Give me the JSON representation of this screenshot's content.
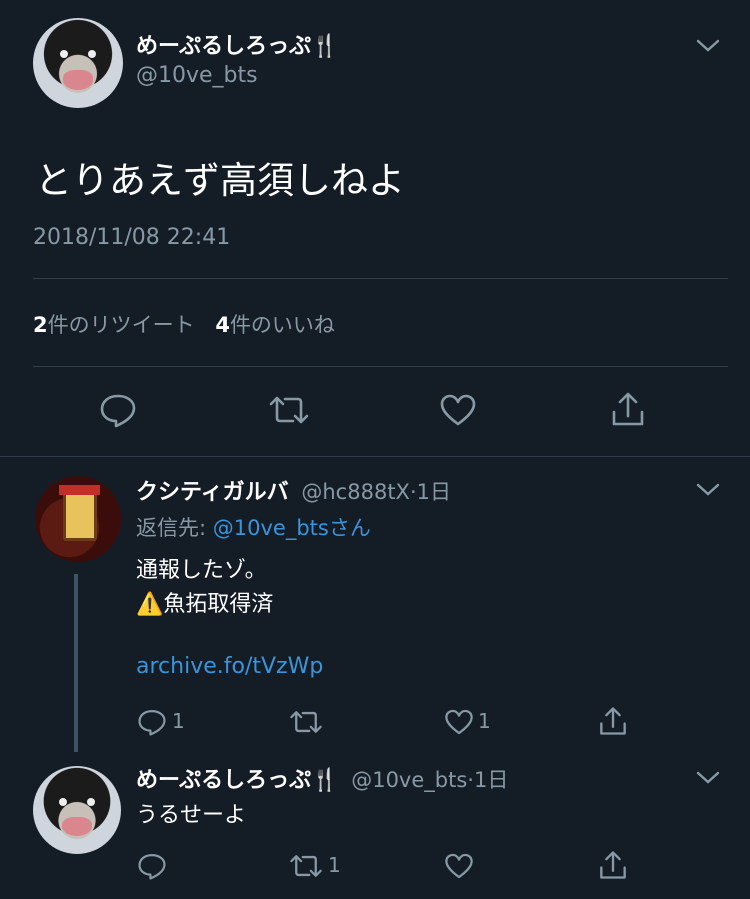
{
  "main_tweet": {
    "display_name": "めーぷるしろっぷ🍴",
    "handle": "@10ve_bts",
    "text": "とりあえず高須しねよ",
    "timestamp": "2018/11/08 22:41",
    "retweet_count": "2",
    "retweet_label": "件のリツイート",
    "like_count": "4",
    "like_label": "件のいいね"
  },
  "replies": [
    {
      "display_name": "クシティガルバ",
      "handle": "@hc888tX",
      "age": "·1日",
      "reply_to_prefix": "返信先: ",
      "reply_to_handle": "@10ve_bts",
      "reply_to_suffix": "さん",
      "line1": "通報したゾ。",
      "line2_emoji": "⚠️",
      "line2_text": "魚拓取得済",
      "link": "archive.fo/tVzWp",
      "reply_count": "1",
      "retweet_count": "",
      "like_count": "1"
    },
    {
      "display_name": "めーぷるしろっぷ🍴",
      "handle": "@10ve_bts",
      "age": "·1日",
      "text": "うるせーよ",
      "reply_count": "",
      "retweet_count": "1",
      "like_count": ""
    }
  ],
  "icons": [
    "chevron-down-icon",
    "reply-icon",
    "retweet-icon",
    "like-icon",
    "share-icon"
  ],
  "colors": {
    "background": "#141d26",
    "muted": "#8899a6",
    "link": "#3b94d9",
    "divider": "#2f3d4a"
  }
}
